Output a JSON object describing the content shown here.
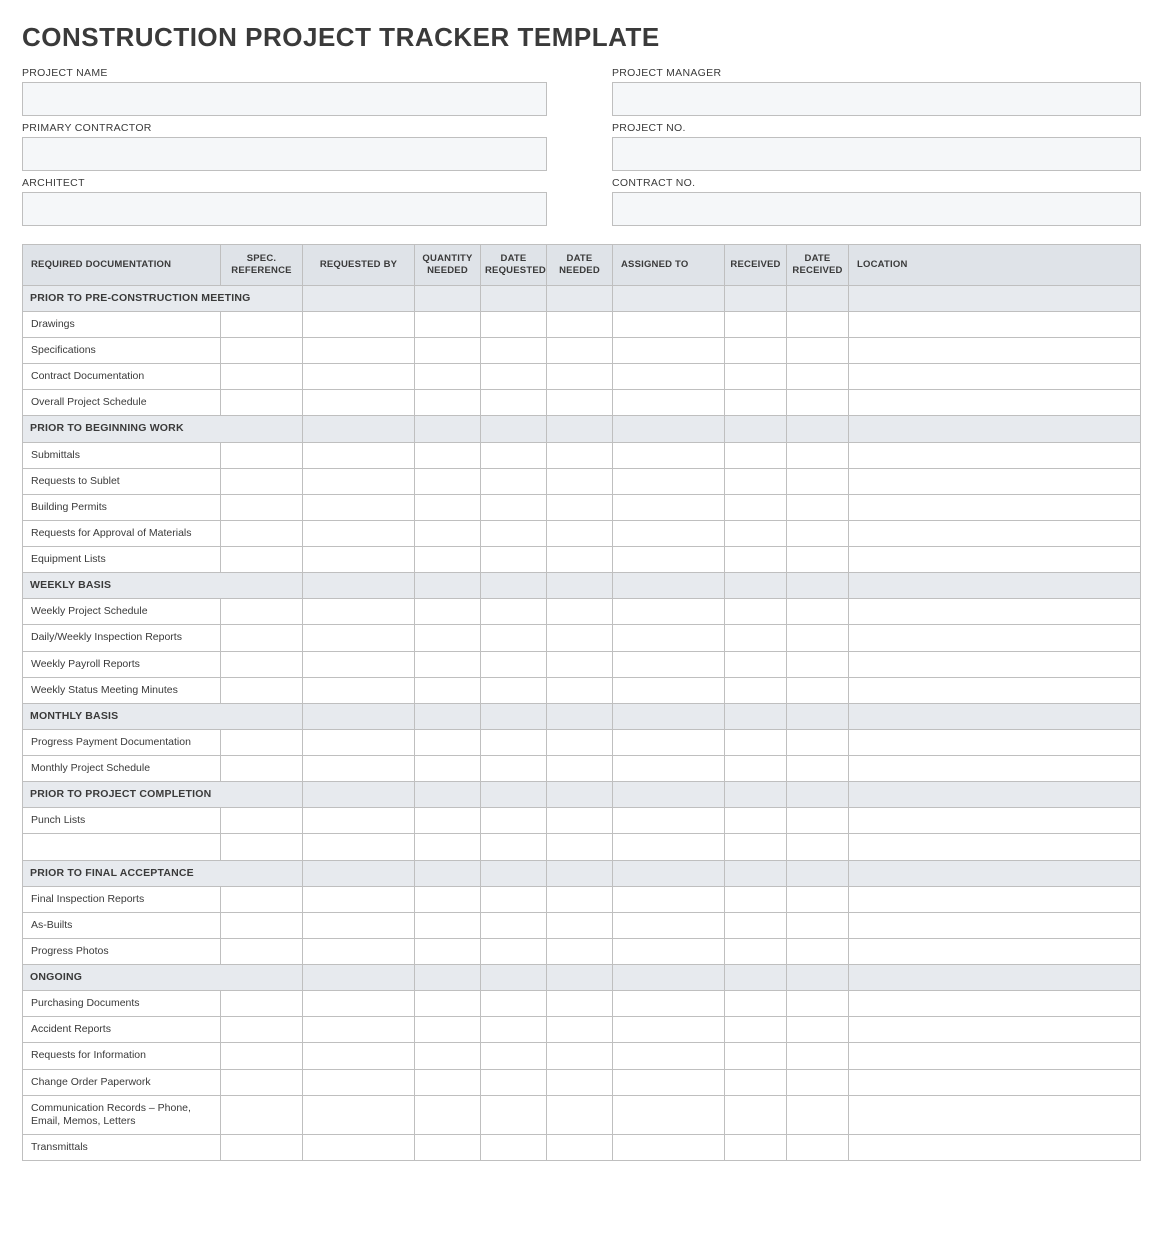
{
  "title": "CONSTRUCTION PROJECT TRACKER TEMPLATE",
  "info": {
    "project_name": {
      "label": "PROJECT NAME",
      "value": ""
    },
    "project_manager": {
      "label": "PROJECT MANAGER",
      "value": ""
    },
    "primary_contractor": {
      "label": "PRIMARY CONTRACTOR",
      "value": ""
    },
    "project_no": {
      "label": "PROJECT NO.",
      "value": ""
    },
    "architect": {
      "label": "ARCHITECT",
      "value": ""
    },
    "contract_no": {
      "label": "CONTRACT NO.",
      "value": ""
    }
  },
  "columns": [
    "REQUIRED DOCUMENTATION",
    "SPEC. REFERENCE",
    "REQUESTED BY",
    "QUANTITY NEEDED",
    "DATE REQUESTED",
    "DATE NEEDED",
    "ASSIGNED TO",
    "RECEIVED",
    "DATE RECEIVED",
    "LOCATION"
  ],
  "sections": [
    {
      "title": "PRIOR TO PRE-CONSTRUCTION MEETING",
      "rows": [
        {
          "doc": "Drawings"
        },
        {
          "doc": "Specifications"
        },
        {
          "doc": "Contract Documentation"
        },
        {
          "doc": "Overall Project Schedule"
        }
      ]
    },
    {
      "title": "PRIOR TO BEGINNING WORK",
      "rows": [
        {
          "doc": "Submittals"
        },
        {
          "doc": "Requests to Sublet"
        },
        {
          "doc": "Building Permits"
        },
        {
          "doc": "Requests for Approval of Materials"
        },
        {
          "doc": "Equipment Lists"
        }
      ]
    },
    {
      "title": "WEEKLY BASIS",
      "rows": [
        {
          "doc": "Weekly Project Schedule"
        },
        {
          "doc": "Daily/Weekly Inspection Reports"
        },
        {
          "doc": "Weekly Payroll Reports"
        },
        {
          "doc": "Weekly Status Meeting Minutes"
        }
      ]
    },
    {
      "title": "MONTHLY BASIS",
      "rows": [
        {
          "doc": "Progress Payment Documentation"
        },
        {
          "doc": "Monthly Project Schedule"
        }
      ]
    },
    {
      "title": "PRIOR TO PROJECT COMPLETION",
      "rows": [
        {
          "doc": "Punch Lists"
        },
        {
          "doc": ""
        }
      ]
    },
    {
      "title": "PRIOR TO FINAL ACCEPTANCE",
      "rows": [
        {
          "doc": "Final Inspection Reports"
        },
        {
          "doc": "As-Builts"
        },
        {
          "doc": "Progress Photos"
        }
      ]
    },
    {
      "title": "ONGOING",
      "rows": [
        {
          "doc": "Purchasing Documents"
        },
        {
          "doc": "Accident Reports"
        },
        {
          "doc": "Requests for Information"
        },
        {
          "doc": "Change Order Paperwork"
        },
        {
          "doc": "Communication Records – Phone, Email, Memos, Letters"
        },
        {
          "doc": "Transmittals"
        }
      ]
    }
  ]
}
